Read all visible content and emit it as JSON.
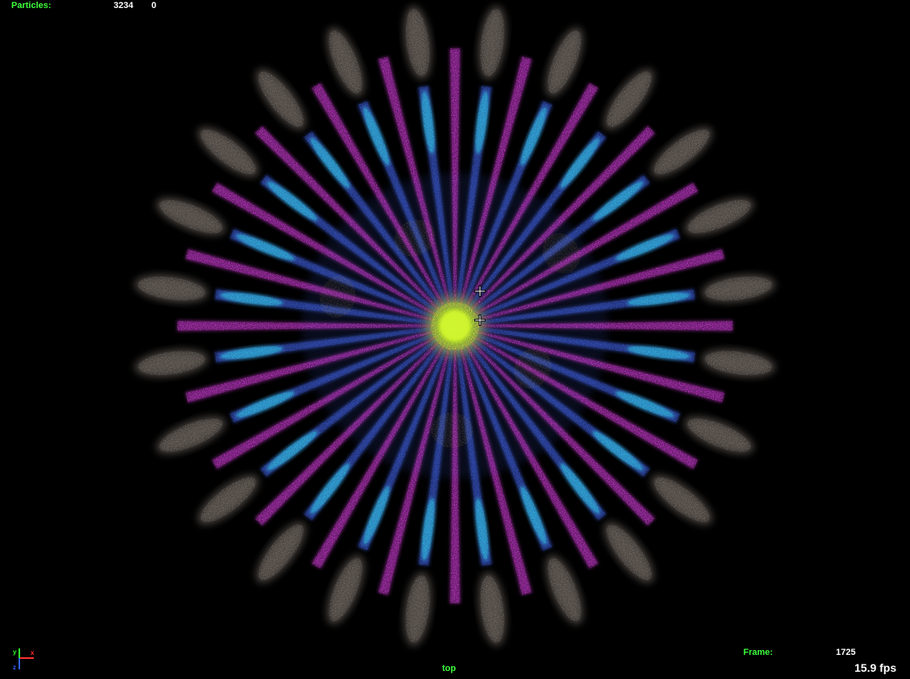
{
  "hud": {
    "particles_label": "Particles:",
    "particles_count": "3234",
    "particles_second_value": "0",
    "frame_label": "Frame:",
    "frame_value": "1725",
    "fps": "15.9 fps",
    "view_name": "top"
  },
  "axis_gizmo": {
    "x_label": "x",
    "y_label": "y",
    "z_label": "z",
    "x_color": "#ff3030",
    "y_color": "#30ff30",
    "z_color": "#3060ff"
  },
  "scene": {
    "background": "#000000",
    "core_color": "#c8f020",
    "ray_count": 24,
    "colors": {
      "magenta": "#e040e8",
      "cyan": "#30c8e8",
      "blue": "#4060e0",
      "grey": "#8a8078",
      "gold": "#c8a850"
    }
  },
  "icons": {
    "cursor": "crosshair-cursor-icon",
    "axis": "axis-gizmo-icon"
  }
}
